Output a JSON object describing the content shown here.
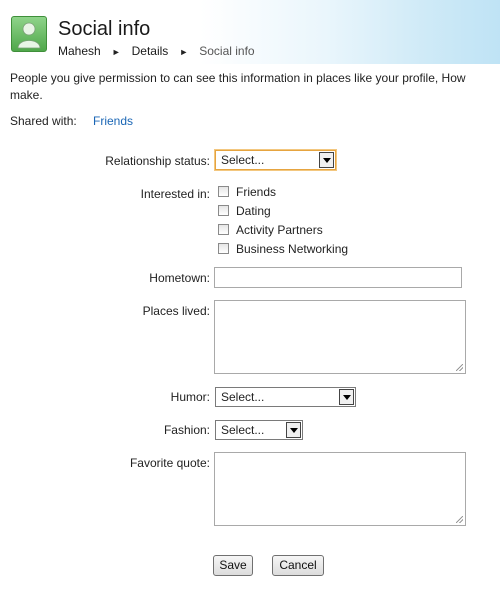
{
  "header": {
    "title": "Social info",
    "breadcrumb": {
      "items": [
        "Mahesh",
        "Details"
      ],
      "current": "Social info",
      "separator": "►"
    },
    "avatar_icon": "person-silhouette-icon"
  },
  "description": "People you give permission to can see this information in places like your profile, How\nmake.",
  "shared_with": {
    "label": "Shared with:",
    "value": "Friends"
  },
  "form": {
    "relationship_status": {
      "label": "Relationship status:",
      "selected": "Select..."
    },
    "interested_in": {
      "label": "Interested in:",
      "options": [
        "Friends",
        "Dating",
        "Activity Partners",
        "Business Networking"
      ]
    },
    "hometown": {
      "label": "Hometown:",
      "value": ""
    },
    "places_lived": {
      "label": "Places lived:",
      "value": ""
    },
    "humor": {
      "label": "Humor:",
      "selected": "Select..."
    },
    "fashion": {
      "label": "Fashion:",
      "selected": "Select..."
    },
    "favorite_quote": {
      "label": "Favorite quote:",
      "value": ""
    }
  },
  "buttons": {
    "save": "Save",
    "cancel": "Cancel"
  },
  "colors": {
    "link": "#1a66b5",
    "focus_border": "#e6a440",
    "avatar_green": "#4fa74a",
    "header_gradient_end": "#bfe3f5"
  }
}
